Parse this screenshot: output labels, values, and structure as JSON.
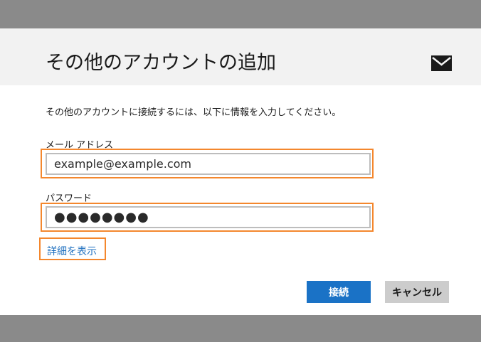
{
  "dialog": {
    "title": "その他のアカウントの追加",
    "description": "その他のアカウントに接続するには、以下に情報を入力してください。",
    "email": {
      "label": "メール アドレス",
      "value": "example@example.com"
    },
    "password": {
      "label": "パスワード",
      "value": "●●●●●●●●"
    },
    "details_link": "詳細を表示",
    "connect_button": "接続",
    "cancel_button": "キャンセル"
  },
  "icons": {
    "header_icon": "mail-icon"
  },
  "colors": {
    "accent": "#1a72c6",
    "highlight": "#f4872d",
    "link": "#1e6fbf",
    "backdrop": "#8a8a8a"
  }
}
